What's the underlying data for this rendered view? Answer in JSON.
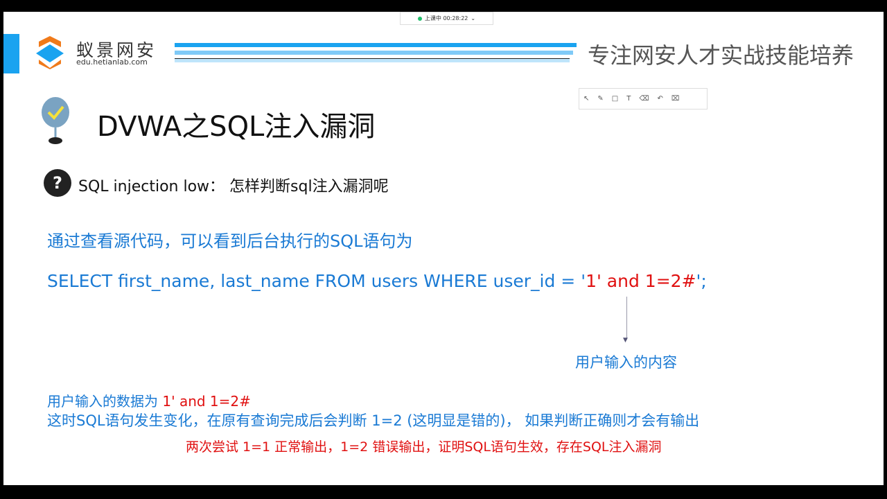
{
  "status": {
    "text": "上课中 00:28:22"
  },
  "logo": {
    "name": "蚁景网安",
    "url": "edu.hetianlab.com"
  },
  "slogan": "专注网安人才实战技能培养",
  "toolbar": {
    "icons": [
      "cursor-icon",
      "pen-icon",
      "rectangle-icon",
      "text-icon",
      "eraser-icon",
      "undo-icon",
      "clear-icon"
    ]
  },
  "slide": {
    "title": "DVWA之SQL注入漏洞",
    "subtitle": "SQL injection low：  怎样判断sql注入漏洞呢",
    "line1": "通过查看源代码，可以看到后台执行的SQL语句为",
    "sql_prefix": "SELECT first_name, last_name FROM users WHERE user_id = '",
    "sql_input": "1' and 1=2#",
    "sql_suffix": "';",
    "annotation": "用户输入的内容",
    "input_label": "用户输入的数据为 ",
    "input_value": "1' and 1=2#",
    "explain": "这时SQL语句发生变化，在原有查询完成后会判断 1=2 (这明显是错的)，  如果判断正确则才会有输出",
    "conclusion": "两次尝试 1=1 正常输出，1=2 错误输出，证明SQL语句生效，存在SQL注入漏洞"
  },
  "colors": {
    "blue": "#1a7ad4",
    "red": "#e01010",
    "accent": "#1aa3f0"
  }
}
